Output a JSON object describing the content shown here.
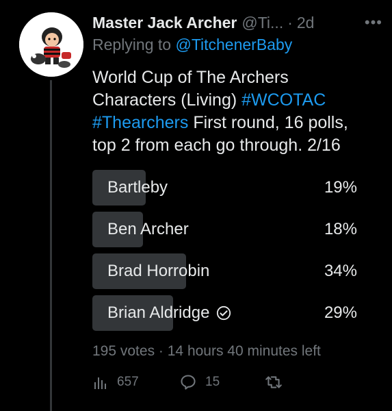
{
  "author": {
    "name": "Master Jack Archer",
    "handle": "@Ti...",
    "time": "2d"
  },
  "reply_prefix": "Replying to",
  "reply_to": "@TitchenerBaby",
  "tweet": {
    "line1": "World Cup of The Archers",
    "line2_text": "Characters (Living)",
    "hashtag1": "#WCOTAC",
    "hashtag2": "#Thearchers",
    "line3_text": "First round, 16 polls,",
    "line4": "top 2 from each go through. 2/16"
  },
  "poll": {
    "options": [
      {
        "label": "Bartleby",
        "percent_text": "19%",
        "percent": 19,
        "bar_fraction": 0.2
      },
      {
        "label": "Ben Archer",
        "percent_text": "18%",
        "percent": 18,
        "bar_fraction": 0.19
      },
      {
        "label": "Brad Horrobin",
        "percent_text": "34%",
        "percent": 34,
        "bar_fraction": 0.35
      },
      {
        "label": "Brian Aldridge",
        "percent_text": "29%",
        "percent": 29,
        "bar_fraction": 0.3,
        "selected": true
      }
    ],
    "votes": "195 votes",
    "time_left": "14 hours 40 minutes left"
  },
  "stats": {
    "views": "657",
    "replies": "15"
  },
  "colors": {
    "accent": "#1d9bf0",
    "muted": "#71767b",
    "bar": "#333639",
    "text": "#e7e9ea"
  },
  "icons": {
    "views": "bar-chart-icon",
    "replies": "speech-bubble-icon",
    "retweet": "retweet-icon",
    "more": "ellipsis-icon",
    "check": "check-circle-icon"
  }
}
